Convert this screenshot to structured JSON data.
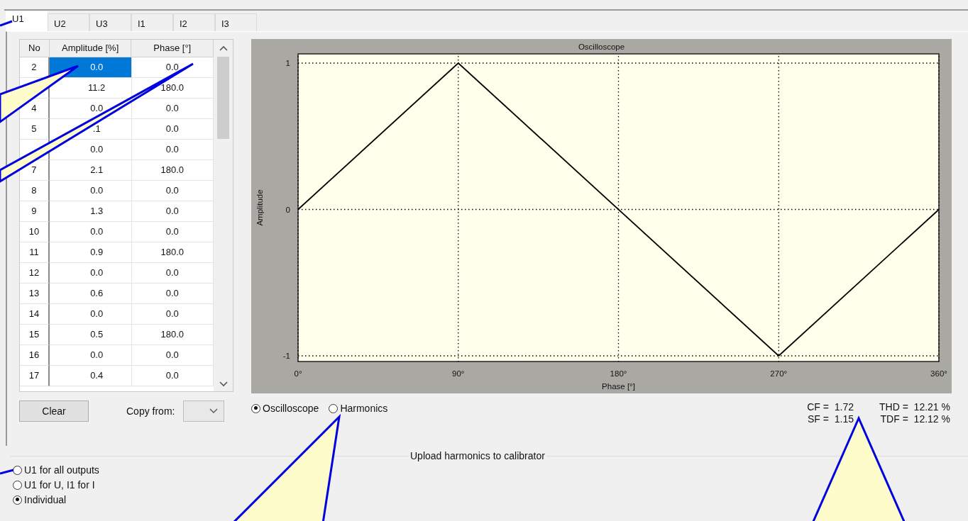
{
  "tabs": [
    {
      "label": "U1",
      "selected": true
    },
    {
      "label": "U2",
      "selected": false
    },
    {
      "label": "U3",
      "selected": false
    },
    {
      "label": "I1",
      "selected": false
    },
    {
      "label": "I2",
      "selected": false
    },
    {
      "label": "I3",
      "selected": false
    }
  ],
  "table": {
    "columns": [
      "No",
      "Amplitude [%]",
      "Phase [°]"
    ],
    "rows": [
      {
        "no": "2",
        "amplitude": "0.0",
        "phase": "0.0",
        "selected": true
      },
      {
        "amplitude": "11.2",
        "phase": "180.0",
        "selected": false
      },
      {
        "no": "4",
        "amplitude": "0.0",
        "phase": "0.0",
        "selected": false
      },
      {
        "no": "5",
        "amplitude": ".1",
        "phase": "0.0",
        "selected": false
      },
      {
        "amplitude": "0.0",
        "phase": "0.0",
        "selected": false
      },
      {
        "no": "7",
        "amplitude": "2.1",
        "phase": "180.0",
        "selected": false
      },
      {
        "no": "8",
        "amplitude": "0.0",
        "phase": "0.0",
        "selected": false
      },
      {
        "no": "9",
        "amplitude": "1.3",
        "phase": "0.0",
        "selected": false
      },
      {
        "no": "10",
        "amplitude": "0.0",
        "phase": "0.0",
        "selected": false
      },
      {
        "no": "11",
        "amplitude": "0.9",
        "phase": "180.0",
        "selected": false
      },
      {
        "no": "12",
        "amplitude": "0.0",
        "phase": "0.0",
        "selected": false
      },
      {
        "no": "13",
        "amplitude": "0.6",
        "phase": "0.0",
        "selected": false
      },
      {
        "no": "14",
        "amplitude": "0.0",
        "phase": "0.0",
        "selected": false
      },
      {
        "no": "15",
        "amplitude": "0.5",
        "phase": "180.0",
        "selected": false
      },
      {
        "no": "16",
        "amplitude": "0.0",
        "phase": "0.0",
        "selected": false
      },
      {
        "no": "17",
        "amplitude": "0.4",
        "phase": "0.0",
        "selected": false
      }
    ]
  },
  "clear_button": "Clear",
  "copy_from": {
    "label": "Copy from:"
  },
  "chart": {
    "chart_data": {
      "type": "line",
      "title": "Oscilloscope",
      "xlabel": "Phase [°]",
      "ylabel": "Amplitude",
      "x": [
        0,
        90,
        270,
        360
      ],
      "series": [
        {
          "color": "#000000",
          "values": [
            0,
            1,
            -1,
            0
          ]
        }
      ],
      "grid": true,
      "xlim": [
        0,
        360
      ],
      "ylim": [
        -1,
        1
      ],
      "xticks": [
        {
          "value": 0,
          "label": "0°"
        },
        {
          "value": 90,
          "label": "90°"
        },
        {
          "value": 180,
          "label": "180°"
        },
        {
          "value": 270,
          "label": "270°"
        },
        {
          "value": 360,
          "label": "360°"
        }
      ],
      "yticks": [
        -1,
        0,
        1
      ]
    }
  },
  "view_modes": [
    {
      "label": "Oscilloscope",
      "selected": true
    },
    {
      "label": "Harmonics",
      "selected": false
    }
  ],
  "stats": [
    {
      "label": "CF =",
      "value": "1.72"
    },
    {
      "label": "THD =",
      "value": "12.21 %"
    },
    {
      "label": "SF =",
      "value": "1.15"
    },
    {
      "label": "TDF =",
      "value": "12.12 %"
    }
  ],
  "upload": {
    "title": "Upload harmonics to calibrator",
    "modes": [
      {
        "label": "U1 for all outputs",
        "selected": false
      },
      {
        "label": "U1 for U, I1 for I",
        "selected": false
      },
      {
        "label": "Individual",
        "selected": true
      }
    ]
  }
}
